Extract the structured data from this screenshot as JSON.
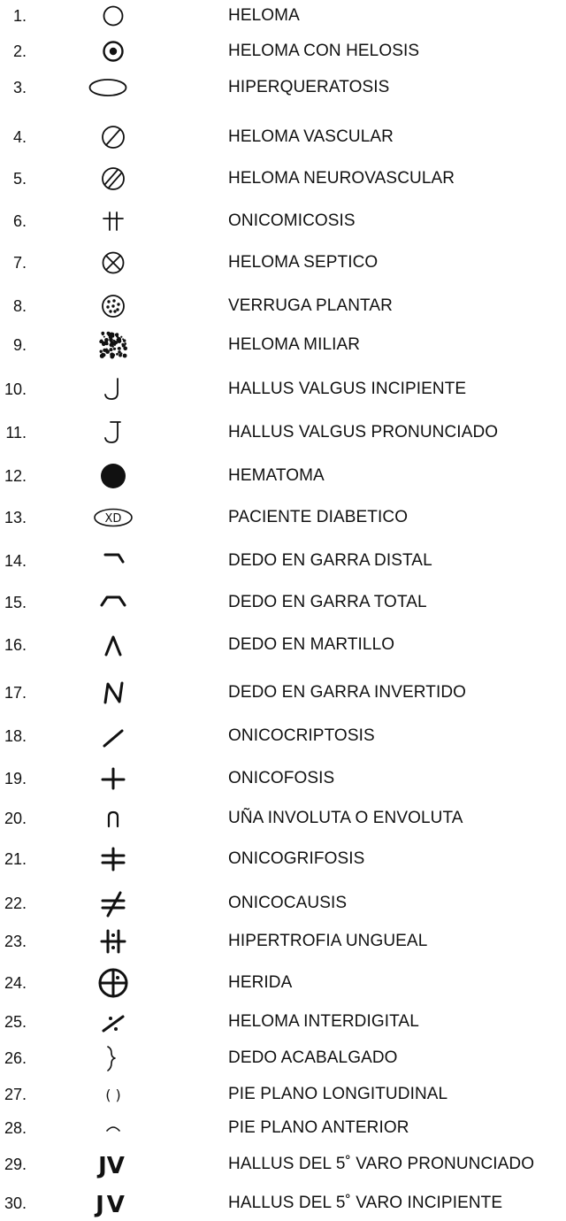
{
  "items": [
    {
      "num": "1.",
      "label": "HELOMA",
      "icon": "circle-icon"
    },
    {
      "num": "2.",
      "label": "HELOMA CON HELOSIS",
      "icon": "dotted-circle-icon"
    },
    {
      "num": "3.",
      "label": "HIPERQUERATOSIS",
      "icon": "ellipse-icon"
    },
    {
      "num": "4.",
      "label": "HELOMA VASCULAR",
      "icon": "slashed-circle-icon"
    },
    {
      "num": "5.",
      "label": "HELOMA NEUROVASCULAR",
      "icon": "double-slashed-circle-icon"
    },
    {
      "num": "6.",
      "label": "ONICOMICOSIS",
      "icon": "double-cross-icon"
    },
    {
      "num": "7.",
      "label": "HELOMA SEPTICO",
      "icon": "crossed-circle-icon"
    },
    {
      "num": "8.",
      "label": "VERRUGA PLANTAR",
      "icon": "dotted-circle-cluster-icon"
    },
    {
      "num": "9.",
      "label": "HELOMA MILIAR",
      "icon": "speckle-square-icon"
    },
    {
      "num": "10.",
      "label": "HALLUS VALGUS INCIPIENTE",
      "icon": "hook-icon"
    },
    {
      "num": "11.",
      "label": "HALLUS VALGUS PRONUNCIADO",
      "icon": "j-hook-icon"
    },
    {
      "num": "12.",
      "label": "HEMATOMA",
      "icon": "filled-circle-icon"
    },
    {
      "num": "13.",
      "label": "PACIENTE DIABETICO",
      "icon": "xd-ellipse-icon",
      "symbol": "XD"
    },
    {
      "num": "14.",
      "label": "DEDO EN GARRA DISTAL",
      "icon": "bent-line-icon"
    },
    {
      "num": "15.",
      "label": "DEDO EN GARRA TOTAL",
      "icon": "trapezoid-line-icon"
    },
    {
      "num": "16.",
      "label": "DEDO EN MARTILLO",
      "icon": "caret-icon"
    },
    {
      "num": "17.",
      "label": "DEDO EN GARRA INVERTIDO",
      "icon": "n-zigzag-icon"
    },
    {
      "num": "18.",
      "label": "ONICOCRIPTOSIS",
      "icon": "diagonal-line-icon"
    },
    {
      "num": "19.",
      "label": "ONICOFOSIS",
      "icon": "inverted-t-icon"
    },
    {
      "num": "20.",
      "label": "UÑA INVOLUTA O ENVOLUTA",
      "icon": "arch-icon"
    },
    {
      "num": "21.",
      "label": "ONICOGRIFOSIS",
      "icon": "double-bar-cross-icon"
    },
    {
      "num": "22.",
      "label": "ONICOCAUSIS",
      "icon": "not-equal-icon"
    },
    {
      "num": "23.",
      "label": "HIPERTROFIA UNGUEAL",
      "icon": "dotted-hash-icon"
    },
    {
      "num": "24.",
      "label": "HERIDA",
      "icon": "target-circle-icon"
    },
    {
      "num": "25.",
      "label": "HELOMA INTERDIGITAL",
      "icon": "dotted-slash-icon"
    },
    {
      "num": "26.",
      "label": "DEDO ACABALGADO",
      "icon": "brace-icon"
    },
    {
      "num": "27.",
      "label": "PIE PLANO LONGITUDINAL",
      "icon": "parentheses-icon",
      "symbol": "( )"
    },
    {
      "num": "28.",
      "label": "PIE PLANO ANTERIOR",
      "icon": "small-arc-icon"
    },
    {
      "num": "29.",
      "label": "HALLUS DEL 5˚ VARO PRONUNCIADO",
      "icon": "jv-pronounced-icon",
      "symbol": "JV"
    },
    {
      "num": "30.",
      "label": "HALLUS DEL 5˚ VARO INCIPIENTE",
      "icon": "jv-incipient-icon",
      "symbol": "JV"
    }
  ]
}
